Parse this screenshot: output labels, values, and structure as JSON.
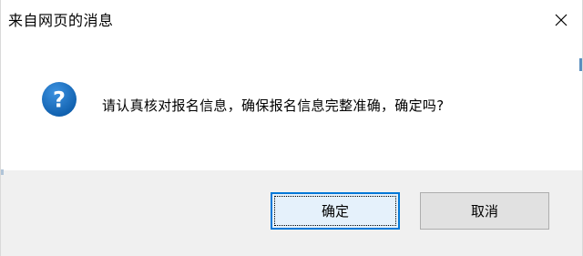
{
  "window": {
    "title": "来自网页的消息"
  },
  "icons": {
    "close": "close-icon",
    "question": "question-icon"
  },
  "message": {
    "text": "请认真核对报名信息，确保报名信息完整准确，确定吗?"
  },
  "buttons": {
    "ok_label": "确定",
    "cancel_label": "取消"
  },
  "colors": {
    "icon_blue": "#1a73c9",
    "focus_border": "#0078d7",
    "button_bar": "#f0f0f0"
  }
}
